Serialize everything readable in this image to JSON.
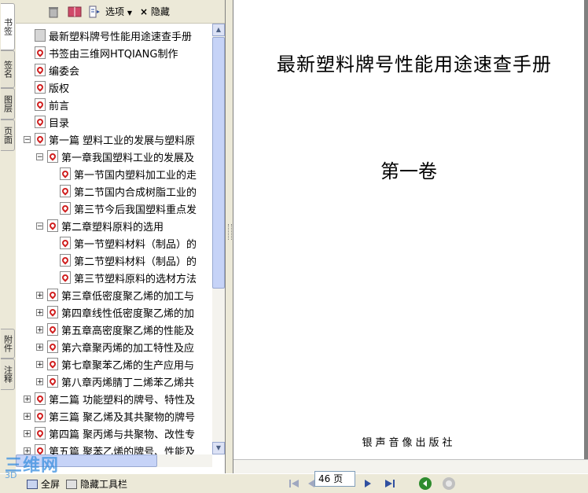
{
  "side_tabs": [
    "书签",
    "签名",
    "图层",
    "页面",
    "附件",
    "注释"
  ],
  "panel_toolbar": {
    "options_label": "选项",
    "hide_label": "隐藏"
  },
  "tree": [
    {
      "label": "最新塑料牌号性能用途速查手册",
      "level": 0,
      "toggle": "",
      "icon": "doc"
    },
    {
      "label": "书签由三维网HTQIANG制作",
      "level": 0,
      "toggle": "",
      "icon": "pdf"
    },
    {
      "label": "编委会",
      "level": 0,
      "toggle": "",
      "icon": "pdf"
    },
    {
      "label": "版权",
      "level": 0,
      "toggle": "",
      "icon": "pdf"
    },
    {
      "label": "前言",
      "level": 0,
      "toggle": "",
      "icon": "pdf"
    },
    {
      "label": "目录",
      "level": 0,
      "toggle": "",
      "icon": "pdf"
    },
    {
      "label": "第一篇 塑料工业的发展与塑料原",
      "level": 0,
      "toggle": "−",
      "icon": "pdf"
    },
    {
      "label": "第一章我国塑料工业的发展及",
      "level": 1,
      "toggle": "−",
      "icon": "pdf"
    },
    {
      "label": "第一节国内塑料加工业的走",
      "level": 2,
      "toggle": "",
      "icon": "pdf"
    },
    {
      "label": "第二节国内合成树脂工业的",
      "level": 2,
      "toggle": "",
      "icon": "pdf"
    },
    {
      "label": "第三节今后我国塑料重点发",
      "level": 2,
      "toggle": "",
      "icon": "pdf"
    },
    {
      "label": "第二章塑料原料的选用",
      "level": 1,
      "toggle": "−",
      "icon": "pdf"
    },
    {
      "label": "第一节塑料材料（制品）的",
      "level": 2,
      "toggle": "",
      "icon": "pdf"
    },
    {
      "label": "第二节塑料材料（制品）的",
      "level": 2,
      "toggle": "",
      "icon": "pdf"
    },
    {
      "label": "第三节塑料原料的选材方法",
      "level": 2,
      "toggle": "",
      "icon": "pdf"
    },
    {
      "label": "第三章低密度聚乙烯的加工与",
      "level": 1,
      "toggle": "+",
      "icon": "pdf"
    },
    {
      "label": "第四章线性低密度聚乙烯的加",
      "level": 1,
      "toggle": "+",
      "icon": "pdf"
    },
    {
      "label": "第五章高密度聚乙烯的性能及",
      "level": 1,
      "toggle": "+",
      "icon": "pdf"
    },
    {
      "label": "第六章聚丙烯的加工特性及应",
      "level": 1,
      "toggle": "+",
      "icon": "pdf"
    },
    {
      "label": "第七章聚苯乙烯的生产应用与",
      "level": 1,
      "toggle": "+",
      "icon": "pdf"
    },
    {
      "label": "第八章丙烯腈丁二烯苯乙烯共",
      "level": 1,
      "toggle": "+",
      "icon": "pdf"
    },
    {
      "label": "第二篇 功能塑料的牌号、特性及",
      "level": 0,
      "toggle": "+",
      "icon": "pdf"
    },
    {
      "label": "第三篇 聚乙烯及其共聚物的牌号",
      "level": 0,
      "toggle": "+",
      "icon": "pdf"
    },
    {
      "label": "第四篇 聚丙烯与共聚物、改性专",
      "level": 0,
      "toggle": "+",
      "icon": "pdf"
    },
    {
      "label": "第五篇 聚苯乙烯的牌号、性能及",
      "level": 0,
      "toggle": "+",
      "icon": "pdf"
    }
  ],
  "page": {
    "title": "最新塑料牌号性能用途速查手册",
    "volume": "第一卷",
    "publisher": "银声音像出版社"
  },
  "status_bar": {
    "fullscreen_label": "全屏",
    "hide_toolbar_label": "隐藏工具栏",
    "page_number": "46 页"
  },
  "watermark": {
    "text": "三维网",
    "sub": "3D"
  },
  "colors": {
    "chrome": "#ece9d8",
    "pdf_red": "#d02020",
    "scroll": "#c6d3f7",
    "nav_green": "#2e8b2e"
  }
}
